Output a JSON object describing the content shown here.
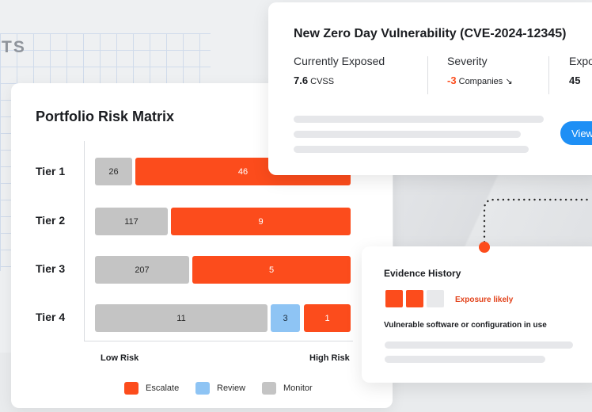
{
  "background": {
    "title_fragment": "TS"
  },
  "matrix": {
    "title": "Portfolio Risk Matrix",
    "tiers": [
      {
        "label": "Tier 1",
        "monitor": 26,
        "review": null,
        "escalate": 46
      },
      {
        "label": "Tier 2",
        "monitor": 117,
        "review": null,
        "escalate": 9
      },
      {
        "label": "Tier 3",
        "monitor": 207,
        "review": null,
        "escalate": 5
      },
      {
        "label": "Tier 4",
        "monitor": 11,
        "review": 3,
        "escalate": 1
      }
    ],
    "axis_low": "Low Risk",
    "axis_high": "High Risk",
    "legend": [
      {
        "label": "Escalate",
        "color": "#fc4c1c"
      },
      {
        "label": "Review",
        "color": "#8ec4f4"
      },
      {
        "label": "Monitor",
        "color": "#c4c4c4"
      }
    ]
  },
  "vulnerability": {
    "title": "New Zero Day Vulnerability (CVE-2024-12345)",
    "metrics": [
      {
        "label": "Currently Exposed",
        "value": "7.6",
        "suffix": "CVSS"
      },
      {
        "label": "Severity",
        "value": "-3",
        "suffix": "Companies ↘"
      },
      {
        "label": "Expo",
        "value": "45",
        "suffix": ""
      }
    ],
    "view_button": "View"
  },
  "evidence": {
    "title": "Evidence History",
    "boxes": [
      "on",
      "on",
      "off"
    ],
    "status": "Exposure likely",
    "description": "Vulnerable software or configuration in use"
  },
  "colors": {
    "escalate": "#fc4c1c",
    "review": "#8ec4f4",
    "monitor": "#c4c4c4",
    "accent": "#1e8ff5"
  }
}
